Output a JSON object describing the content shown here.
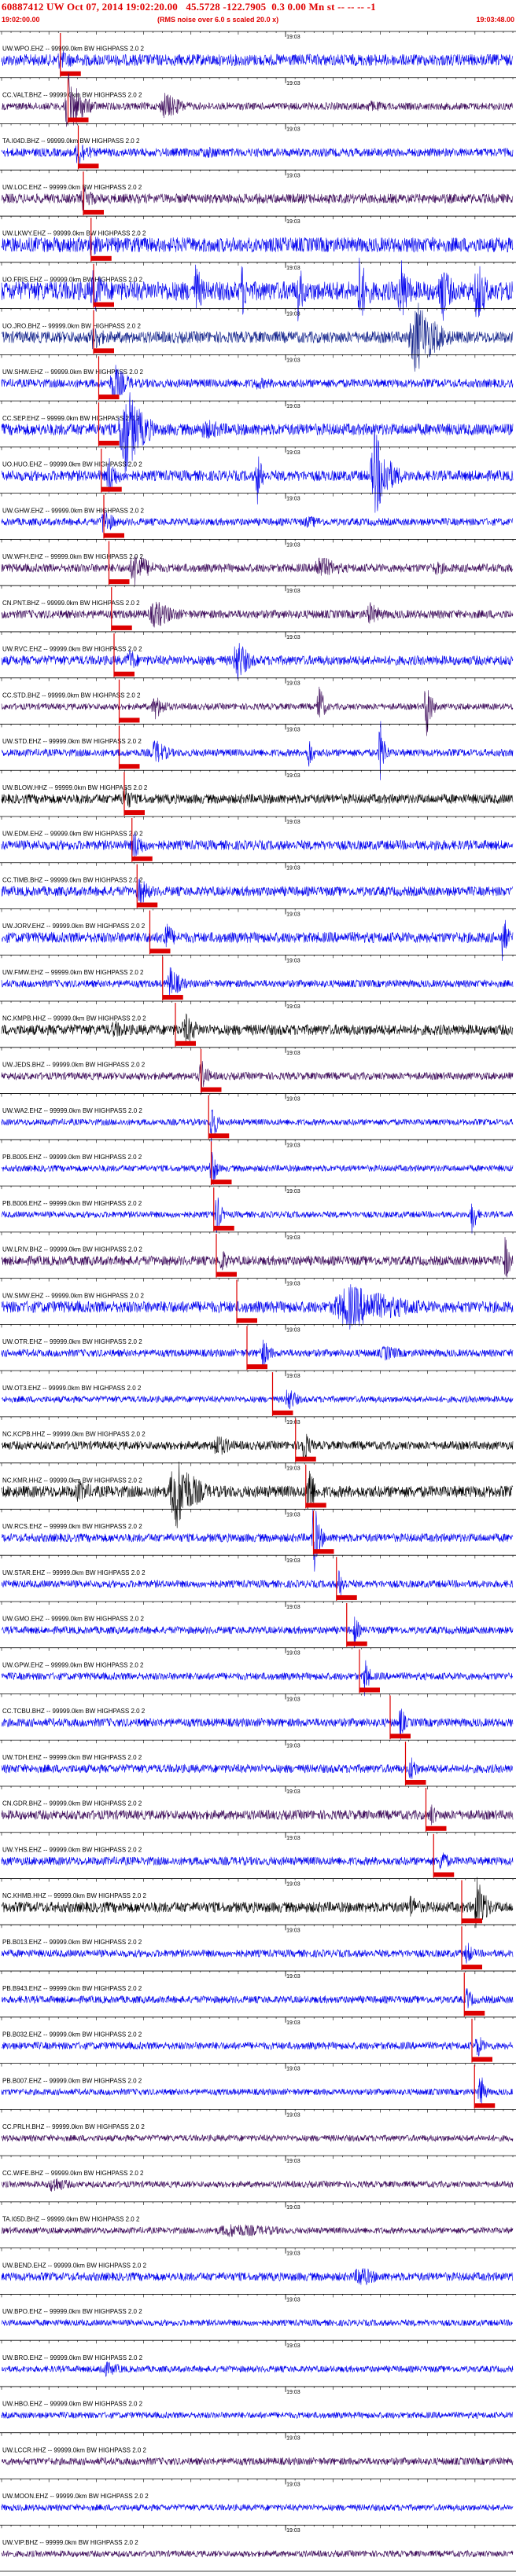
{
  "header": {
    "title": "60887412 UW Oct 07, 2014 19:02:20.00   45.5728 -122.7905  0.3 0.00 Mn st -- -- -- -1",
    "start_time": "19:02:00.00",
    "noise_note": "(RMS noise over 6.0 s scaled 20.0 x)",
    "end_time": "19:03:48.00"
  },
  "colors": {
    "header_red": "#e00000",
    "pick_red": "#dd0000",
    "blue": "#0000ee",
    "black": "#000000",
    "purple": "#3c0a5a",
    "navy": "#10208a"
  },
  "chart_data": {
    "type": "seismogram",
    "xlim": [
      "19:02:00.00",
      "19:03:48.00"
    ],
    "minute_tick_label": "19:03",
    "filter_suffix": " -- 99999.0km BW  HIGHPASS  2.0  2",
    "traces": [
      {
        "station": "UW.WPO.EHZ",
        "color": "blue",
        "amp": 0.55,
        "pick": 0.115,
        "bursts": [
          [
            0.115,
            0.1,
            1.0
          ],
          [
            0.3,
            0.2,
            0.5
          ],
          [
            0.55,
            0.2,
            0.4
          ]
        ]
      },
      {
        "station": "CC.VALT.BHZ",
        "color": "purple",
        "amp": 0.35,
        "pick": 0.13,
        "bursts": [
          [
            0.13,
            0.06,
            3.2
          ],
          [
            0.32,
            0.08,
            1.4
          ],
          [
            0.72,
            0.12,
            0.6
          ]
        ]
      },
      {
        "station": "TA.I04D.BHZ",
        "color": "blue",
        "amp": 0.4,
        "pick": 0.15,
        "bursts": [
          [
            0.15,
            0.05,
            1.5
          ],
          [
            0.4,
            0.2,
            0.6
          ]
        ]
      },
      {
        "station": "UW.LOC.EHZ",
        "color": "purple",
        "amp": 0.45,
        "pick": 0.16,
        "bursts": [
          [
            0.16,
            0.05,
            1.4
          ],
          [
            0.5,
            0.25,
            0.5
          ]
        ]
      },
      {
        "station": "UW.LKWY.EHZ",
        "color": "blue",
        "amp": 0.7,
        "pick": 0.175,
        "bursts": [
          [
            0.175,
            0.05,
            1.3
          ],
          [
            0.5,
            0.3,
            0.6
          ]
        ]
      },
      {
        "station": "UO.FRIS.EHZ",
        "color": "blue",
        "amp": 0.9,
        "pick": 0.18,
        "bursts": [
          [
            0.18,
            0.06,
            2.2
          ],
          [
            0.38,
            0.03,
            3.0
          ],
          [
            0.47,
            0.02,
            3.0
          ],
          [
            0.58,
            0.03,
            3.0
          ],
          [
            0.7,
            0.04,
            3.5
          ],
          [
            0.78,
            0.04,
            3.5
          ],
          [
            0.86,
            0.04,
            3.5
          ],
          [
            0.93,
            0.04,
            3.5
          ]
        ]
      },
      {
        "station": "UO.JRO.BHZ",
        "color": "navy",
        "amp": 0.55,
        "pick": 0.18,
        "bursts": [
          [
            0.18,
            0.05,
            1.5
          ],
          [
            0.81,
            0.09,
            3.8
          ]
        ]
      },
      {
        "station": "UW.SHW.EHZ",
        "color": "blue",
        "amp": 0.4,
        "pick": 0.19,
        "bursts": [
          [
            0.22,
            0.06,
            2.0
          ],
          [
            0.5,
            0.2,
            0.6
          ]
        ]
      },
      {
        "station": "CC.SEP.EHZ",
        "color": "blue",
        "amp": 0.55,
        "pick": 0.19,
        "bursts": [
          [
            0.24,
            0.07,
            5.0
          ],
          [
            0.4,
            0.15,
            1.0
          ]
        ]
      },
      {
        "station": "UO.HUO.EHZ",
        "color": "blue",
        "amp": 0.5,
        "pick": 0.195,
        "bursts": [
          [
            0.21,
            0.04,
            2.0
          ],
          [
            0.5,
            0.02,
            3.0
          ],
          [
            0.73,
            0.06,
            4.5
          ]
        ]
      },
      {
        "station": "UW.GHW.EHZ",
        "color": "blue",
        "amp": 0.35,
        "pick": 0.2,
        "bursts": [
          [
            0.2,
            0.04,
            1.6
          ],
          [
            0.6,
            0.15,
            0.6
          ]
        ]
      },
      {
        "station": "UW.WFH.EHZ",
        "color": "purple",
        "amp": 0.4,
        "pick": 0.21,
        "bursts": [
          [
            0.26,
            0.07,
            1.8
          ],
          [
            0.62,
            0.1,
            1.3
          ],
          [
            0.85,
            0.1,
            0.7
          ]
        ]
      },
      {
        "station": "CN.PNT.BHZ",
        "color": "purple",
        "amp": 0.4,
        "pick": 0.215,
        "bursts": [
          [
            0.3,
            0.1,
            1.4
          ],
          [
            0.72,
            0.06,
            1.2
          ]
        ]
      },
      {
        "station": "UW.RVC.EHZ",
        "color": "blue",
        "amp": 0.45,
        "pick": 0.22,
        "bursts": [
          [
            0.46,
            0.05,
            2.4
          ],
          [
            0.25,
            0.05,
            1.2
          ]
        ]
      },
      {
        "station": "CC.STD.BHZ",
        "color": "purple",
        "amp": 0.3,
        "pick": 0.23,
        "bursts": [
          [
            0.83,
            0.02,
            4.0
          ],
          [
            0.62,
            0.02,
            3.0
          ],
          [
            0.3,
            0.05,
            1.3
          ]
        ]
      },
      {
        "station": "UW.STD.EHZ",
        "color": "blue",
        "amp": 0.35,
        "pick": 0.23,
        "bursts": [
          [
            0.74,
            0.02,
            3.5
          ],
          [
            0.6,
            0.02,
            2.0
          ],
          [
            0.3,
            0.06,
            1.4
          ]
        ]
      },
      {
        "station": "UW.BLOW.HHZ",
        "color": "black",
        "amp": 0.45,
        "pick": 0.24,
        "bursts": [
          [
            0.24,
            0.04,
            1.5
          ]
        ]
      },
      {
        "station": "UW.EDM.EHZ",
        "color": "blue",
        "amp": 0.45,
        "pick": 0.255,
        "bursts": [
          [
            0.26,
            0.05,
            1.5
          ],
          [
            0.85,
            0.15,
            0.6
          ]
        ]
      },
      {
        "station": "CC.TIMB.BHZ",
        "color": "blue",
        "amp": 0.45,
        "pick": 0.265,
        "bursts": [
          [
            0.27,
            0.05,
            1.5
          ],
          [
            0.5,
            0.3,
            0.5
          ]
        ]
      },
      {
        "station": "UW.JORV.EHZ",
        "color": "blue",
        "amp": 0.5,
        "pick": 0.29,
        "bursts": [
          [
            0.32,
            0.04,
            1.8
          ],
          [
            0.98,
            0.02,
            3.0
          ]
        ]
      },
      {
        "station": "UW.FMW.EHZ",
        "color": "blue",
        "amp": 0.35,
        "pick": 0.315,
        "bursts": [
          [
            0.33,
            0.05,
            1.7
          ]
        ]
      },
      {
        "station": "NC.KMPB.HHZ",
        "color": "black",
        "amp": 0.5,
        "pick": 0.34,
        "bursts": [
          [
            0.36,
            0.06,
            1.6
          ],
          [
            0.22,
            0.1,
            0.9
          ]
        ]
      },
      {
        "station": "UW.JEDS.BHZ",
        "color": "purple",
        "amp": 0.35,
        "pick": 0.39,
        "bursts": [
          [
            0.39,
            0.03,
            1.9
          ]
        ]
      },
      {
        "station": "UW.WA2.EHZ",
        "color": "blue",
        "amp": 0.3,
        "pick": 0.405,
        "bursts": [
          [
            0.41,
            0.02,
            3.0
          ]
        ]
      },
      {
        "station": "PB.B005.EHZ",
        "color": "blue",
        "amp": 0.3,
        "pick": 0.41,
        "bursts": [
          [
            0.41,
            0.02,
            2.6
          ]
        ]
      },
      {
        "station": "PB.B006.EHZ",
        "color": "blue",
        "amp": 0.3,
        "pick": 0.415,
        "bursts": [
          [
            0.42,
            0.02,
            2.4
          ],
          [
            0.92,
            0.02,
            2.2
          ]
        ]
      },
      {
        "station": "UW.LRIV.BHZ",
        "color": "purple",
        "amp": 0.45,
        "pick": 0.42,
        "bursts": [
          [
            0.43,
            0.03,
            1.4
          ],
          [
            0.985,
            0.02,
            2.6
          ]
        ]
      },
      {
        "station": "UW.SMW.EHZ",
        "color": "blue",
        "amp": 0.55,
        "pick": 0.46,
        "bursts": [
          [
            0.68,
            0.25,
            2.2
          ]
        ]
      },
      {
        "station": "UW.OTR.EHZ",
        "color": "blue",
        "amp": 0.35,
        "pick": 0.48,
        "bursts": [
          [
            0.51,
            0.04,
            1.5
          ],
          [
            0.75,
            0.1,
            0.8
          ]
        ]
      },
      {
        "station": "UW.OT3.EHZ",
        "color": "blue",
        "amp": 0.3,
        "pick": 0.53,
        "bursts": [
          [
            0.56,
            0.04,
            1.4
          ]
        ]
      },
      {
        "station": "NC.KCPB.HHZ",
        "color": "black",
        "amp": 0.4,
        "pick": 0.575,
        "bursts": [
          [
            0.59,
            0.03,
            2.0
          ],
          [
            0.42,
            0.08,
            1.2
          ]
        ]
      },
      {
        "station": "NC.KMR.HHZ",
        "color": "black",
        "amp": 0.55,
        "pick": 0.595,
        "bursts": [
          [
            0.34,
            0.08,
            4.0
          ],
          [
            0.6,
            0.02,
            4.2
          ],
          [
            0.15,
            0.1,
            1.1
          ]
        ]
      },
      {
        "station": "UW.RCS.EHZ",
        "color": "blue",
        "amp": 0.4,
        "pick": 0.61,
        "bursts": [
          [
            0.61,
            0.025,
            4.0
          ]
        ]
      },
      {
        "station": "UW.STAR.EHZ",
        "color": "blue",
        "amp": 0.35,
        "pick": 0.655,
        "bursts": [
          [
            0.66,
            0.03,
            1.5
          ]
        ]
      },
      {
        "station": "UW.GMO.EHZ",
        "color": "blue",
        "amp": 0.35,
        "pick": 0.675,
        "bursts": [
          [
            0.69,
            0.02,
            1.8
          ]
        ]
      },
      {
        "station": "UW.GPW.EHZ",
        "color": "blue",
        "amp": 0.35,
        "pick": 0.7,
        "bursts": [
          [
            0.71,
            0.02,
            2.2
          ]
        ]
      },
      {
        "station": "CC.TCBU.BHZ",
        "color": "blue",
        "amp": 0.4,
        "pick": 0.76,
        "bursts": [
          [
            0.78,
            0.02,
            2.0
          ]
        ]
      },
      {
        "station": "UW.TDH.EHZ",
        "color": "blue",
        "amp": 0.4,
        "pick": 0.79,
        "bursts": [
          [
            0.8,
            0.03,
            1.5
          ]
        ]
      },
      {
        "station": "CN.GDR.BHZ",
        "color": "purple",
        "amp": 0.45,
        "pick": 0.83,
        "bursts": [
          [
            0.84,
            0.03,
            1.3
          ]
        ]
      },
      {
        "station": "UW.YHS.EHZ",
        "color": "blue",
        "amp": 0.4,
        "pick": 0.845,
        "bursts": [
          [
            0.86,
            0.03,
            1.5
          ]
        ]
      },
      {
        "station": "NC.KHMB.HHZ",
        "color": "black",
        "amp": 0.5,
        "pick": 0.9,
        "bursts": [
          [
            0.93,
            0.04,
            3.0
          ],
          [
            0.8,
            0.05,
            1.3
          ]
        ]
      },
      {
        "station": "PB.B013.EHZ",
        "color": "blue",
        "amp": 0.35,
        "pick": 0.9,
        "bursts": [
          [
            0.91,
            0.03,
            1.3
          ]
        ]
      },
      {
        "station": "PB.B943.EHZ",
        "color": "blue",
        "amp": 0.35,
        "pick": 0.905,
        "bursts": [
          [
            0.91,
            0.03,
            1.3
          ]
        ]
      },
      {
        "station": "PB.B032.EHZ",
        "color": "blue",
        "amp": 0.35,
        "pick": 0.92,
        "bursts": [
          [
            0.93,
            0.03,
            1.4
          ]
        ]
      },
      {
        "station": "PB.B007.EHZ",
        "color": "blue",
        "amp": 0.3,
        "pick": 0.925,
        "bursts": [
          [
            0.935,
            0.02,
            2.4
          ]
        ]
      },
      {
        "station": "CC.PRLH.BHZ",
        "color": "purple",
        "amp": 0.3,
        "pick": null,
        "bursts": []
      },
      {
        "station": "CC.WIFE.BHZ",
        "color": "purple",
        "amp": 0.3,
        "pick": null,
        "bursts": [
          [
            0.1,
            0.08,
            0.9
          ]
        ]
      },
      {
        "station": "TA.I05D.BHZ",
        "color": "purple",
        "amp": 0.3,
        "pick": null,
        "bursts": [
          [
            0.45,
            0.3,
            0.7
          ]
        ]
      },
      {
        "station": "UW.BEND.EHZ",
        "color": "blue",
        "amp": 0.4,
        "pick": null,
        "bursts": [
          [
            0.7,
            0.08,
            1.2
          ]
        ]
      },
      {
        "station": "UW.BPO.EHZ",
        "color": "blue",
        "amp": 0.3,
        "pick": null,
        "bursts": []
      },
      {
        "station": "UW.BRO.EHZ",
        "color": "blue",
        "amp": 0.3,
        "pick": null,
        "bursts": [
          [
            0.2,
            0.1,
            0.8
          ]
        ]
      },
      {
        "station": "UW.HBO.EHZ",
        "color": "blue",
        "amp": 0.3,
        "pick": null,
        "bursts": []
      },
      {
        "station": "UW.LCCR.HHZ",
        "color": "purple",
        "amp": 0.35,
        "pick": null,
        "bursts": []
      },
      {
        "station": "UW.MOON.EHZ",
        "color": "blue",
        "amp": 0.3,
        "pick": null,
        "bursts": []
      },
      {
        "station": "UW.VIP.BHZ",
        "color": "purple",
        "amp": 0.3,
        "pick": null,
        "bursts": []
      }
    ]
  }
}
